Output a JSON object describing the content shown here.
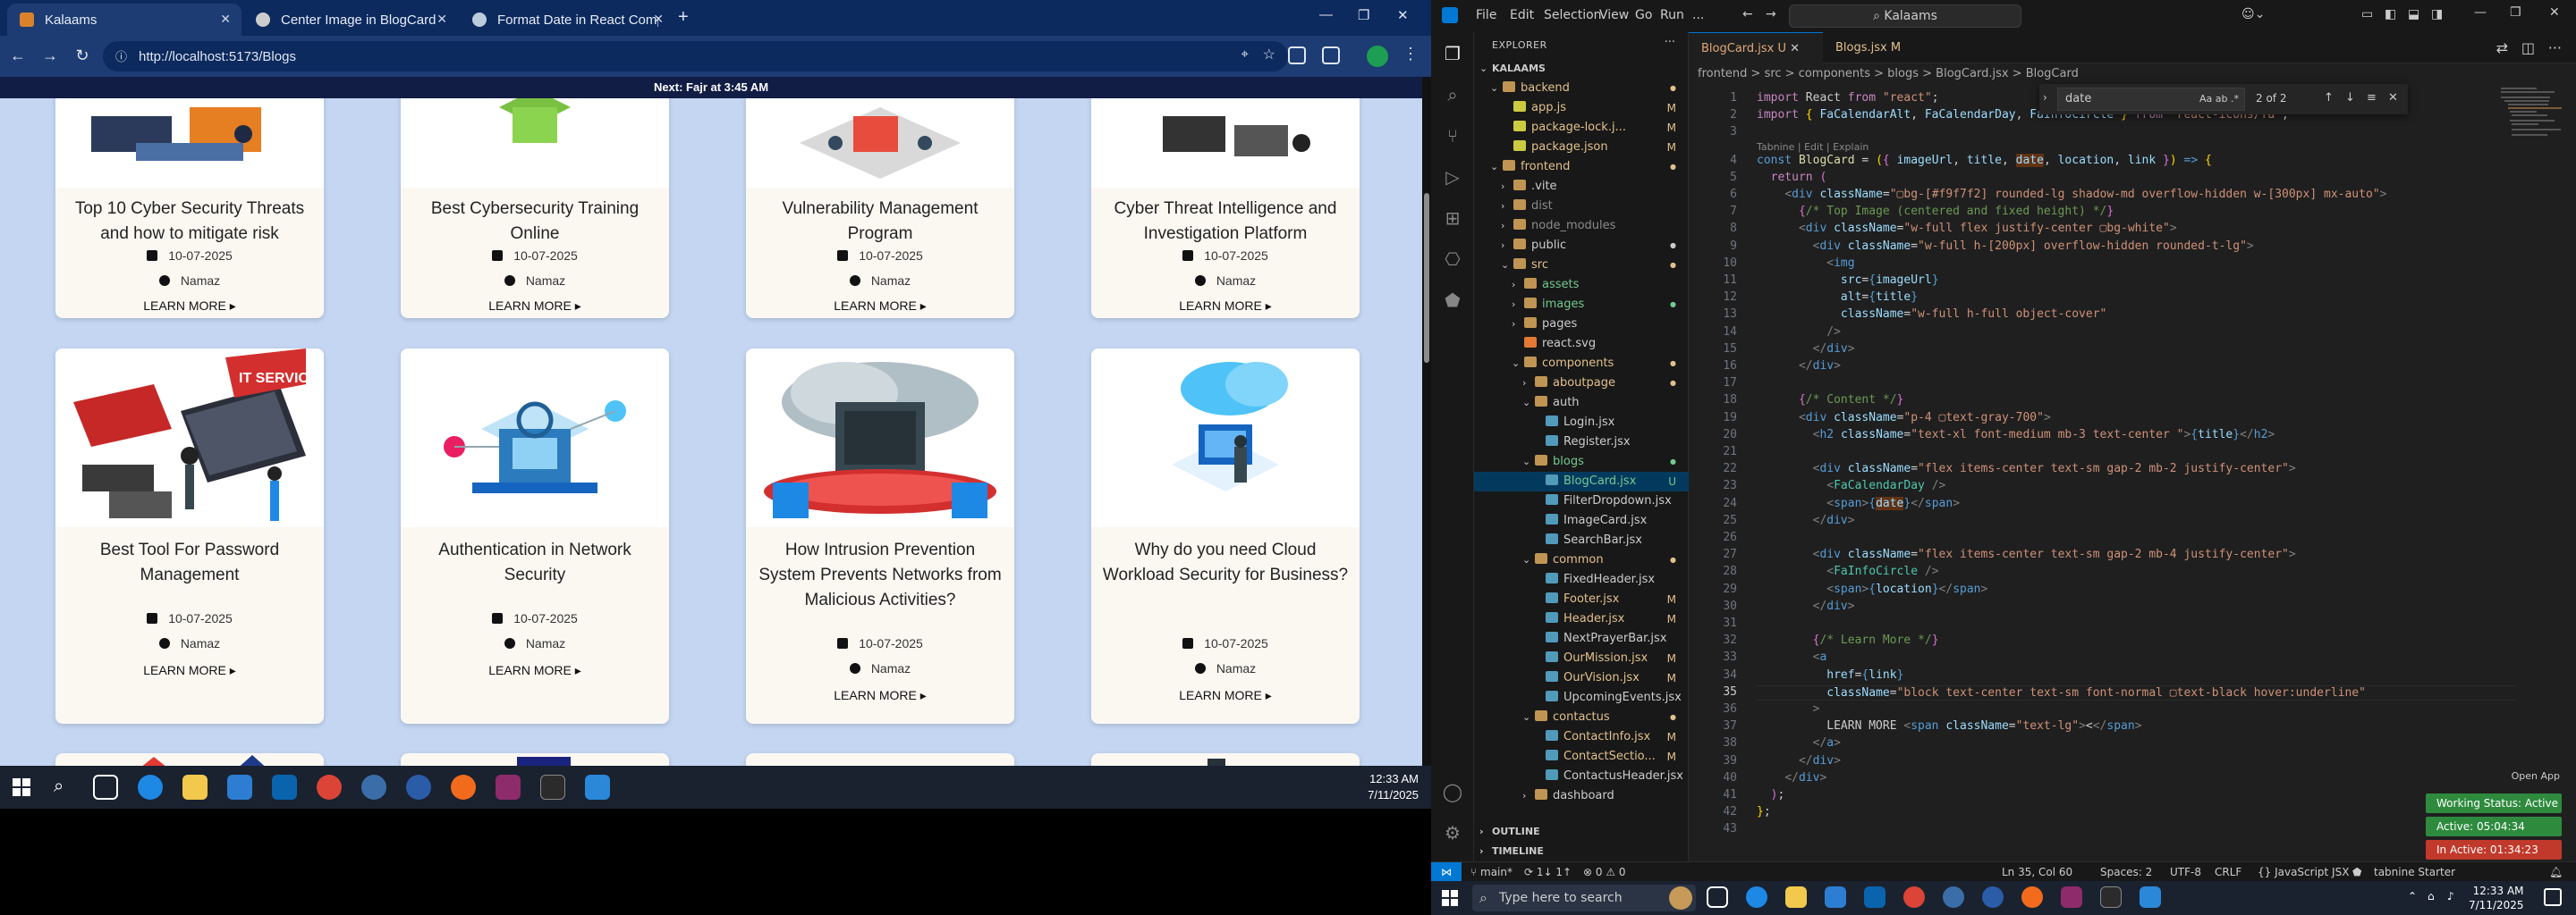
{
  "browser": {
    "tabs": [
      {
        "label": "Kalaams",
        "active": true
      },
      {
        "label": "Center Image in BlogCard",
        "active": false
      },
      {
        "label": "Format Date in React Compone",
        "active": false
      }
    ],
    "url": "http://localhost:5173/Blogs",
    "notice": "Next: Fajr at 3:45 AM"
  },
  "blog": {
    "cards_row1": [
      {
        "title": "Top 10 Cyber Security Threats and how to mitigate risk",
        "date": "10-07-2025",
        "author": "Namaz",
        "more": "LEARN MORE ▸"
      },
      {
        "title": "Best Cybersecurity Training Online",
        "date": "10-07-2025",
        "author": "Namaz",
        "more": "LEARN MORE ▸"
      },
      {
        "title": "Vulnerability Management Program",
        "date": "10-07-2025",
        "author": "Namaz",
        "more": "LEARN MORE ▸"
      },
      {
        "title": "Cyber Threat Intelligence and Investigation Platform",
        "date": "10-07-2025",
        "author": "Namaz",
        "more": "LEARN MORE ▸"
      }
    ],
    "cards_row2": [
      {
        "title": "Best Tool For Password Management",
        "date": "10-07-2025",
        "author": "Namaz",
        "more": "LEARN MORE ▸",
        "img_text": "IT SERVICE"
      },
      {
        "title": "Authentication in Network Security",
        "date": "10-07-2025",
        "author": "Namaz",
        "more": "LEARN MORE ▸"
      },
      {
        "title": "How Intrusion Prevention System Prevents Networks from Malicious Activities?",
        "date": "10-07-2025",
        "author": "Namaz",
        "more": "LEARN MORE ▸"
      },
      {
        "title": "Why do you need Cloud Workload Security for Business?",
        "date": "10-07-2025",
        "author": "Namaz",
        "more": "LEARN MORE ▸"
      }
    ]
  },
  "left_taskbar": {
    "time": "12:33 AM",
    "date": "7/11/2025"
  },
  "vscode": {
    "menu": [
      "File",
      "Edit",
      "Selection",
      "View",
      "Go",
      "Run",
      "..."
    ],
    "command_center": "Kalaams",
    "explorer_title": "EXPLORER",
    "tree": [
      {
        "label": "KALAAMS",
        "indent": 0,
        "chev": "⌄",
        "kind": "root",
        "status": ""
      },
      {
        "label": "backend",
        "indent": 1,
        "chev": "⌄",
        "kind": "folder",
        "status": "dot",
        "color": "#e2c08d"
      },
      {
        "label": "app.js",
        "indent": 2,
        "chev": "",
        "kind": "js",
        "status": "M",
        "color": "#e2c08d"
      },
      {
        "label": "package-lock.j...",
        "indent": 2,
        "chev": "",
        "kind": "json",
        "status": "M",
        "color": "#e2c08d"
      },
      {
        "label": "package.json",
        "indent": 2,
        "chev": "",
        "kind": "json",
        "status": "M",
        "color": "#e2c08d"
      },
      {
        "label": "frontend",
        "indent": 1,
        "chev": "⌄",
        "kind": "folder",
        "status": "dot",
        "color": "#e2c08d"
      },
      {
        "label": ".vite",
        "indent": 2,
        "chev": "›",
        "kind": "folder",
        "status": "",
        "color": "#ccc"
      },
      {
        "label": "dist",
        "indent": 2,
        "chev": "›",
        "kind": "folder",
        "status": "",
        "color": "#8c8c8c"
      },
      {
        "label": "node_modules",
        "indent": 2,
        "chev": "›",
        "kind": "folder",
        "status": "",
        "color": "#8c8c8c"
      },
      {
        "label": "public",
        "indent": 2,
        "chev": "›",
        "kind": "folder",
        "status": "dot",
        "color": "#ccc"
      },
      {
        "label": "src",
        "indent": 2,
        "chev": "⌄",
        "kind": "folder",
        "status": "dot",
        "color": "#e2c08d"
      },
      {
        "label": "assets",
        "indent": 3,
        "chev": "›",
        "kind": "folder",
        "status": "",
        "color": "#73c991"
      },
      {
        "label": "images",
        "indent": 3,
        "chev": "›",
        "kind": "folder",
        "status": "dot",
        "color": "#73c991"
      },
      {
        "label": "pages",
        "indent": 3,
        "chev": "›",
        "kind": "folder",
        "status": "",
        "color": "#ccc"
      },
      {
        "label": "react.svg",
        "indent": 3,
        "chev": "",
        "kind": "svg",
        "status": "",
        "color": "#ccc"
      },
      {
        "label": "components",
        "indent": 3,
        "chev": "⌄",
        "kind": "folder",
        "status": "dot",
        "color": "#e2c08d"
      },
      {
        "label": "aboutpage",
        "indent": 4,
        "chev": "›",
        "kind": "folder",
        "status": "dot",
        "color": "#e2c08d"
      },
      {
        "label": "auth",
        "indent": 4,
        "chev": "⌄",
        "kind": "folder",
        "status": "",
        "color": "#ccc"
      },
      {
        "label": "Login.jsx",
        "indent": 5,
        "chev": "",
        "kind": "jsx",
        "status": "",
        "color": "#ccc"
      },
      {
        "label": "Register.jsx",
        "indent": 5,
        "chev": "",
        "kind": "jsx",
        "status": "",
        "color": "#ccc"
      },
      {
        "label": "blogs",
        "indent": 4,
        "chev": "⌄",
        "kind": "folder",
        "status": "dot",
        "color": "#73c991"
      },
      {
        "label": "BlogCard.jsx",
        "indent": 5,
        "chev": "",
        "kind": "jsx",
        "status": "U",
        "color": "#73c991",
        "selected": true
      },
      {
        "label": "FilterDropdown.jsx",
        "indent": 5,
        "chev": "",
        "kind": "jsx",
        "status": "",
        "color": "#ccc"
      },
      {
        "label": "ImageCard.jsx",
        "indent": 5,
        "chev": "",
        "kind": "jsx",
        "status": "",
        "color": "#ccc"
      },
      {
        "label": "SearchBar.jsx",
        "indent": 5,
        "chev": "",
        "kind": "jsx",
        "status": "",
        "color": "#ccc"
      },
      {
        "label": "common",
        "indent": 4,
        "chev": "⌄",
        "kind": "folder",
        "status": "dot",
        "color": "#e2c08d"
      },
      {
        "label": "FixedHeader.jsx",
        "indent": 5,
        "chev": "",
        "kind": "jsx",
        "status": "",
        "color": "#ccc"
      },
      {
        "label": "Footer.jsx",
        "indent": 5,
        "chev": "",
        "kind": "jsx",
        "status": "M",
        "color": "#e2c08d"
      },
      {
        "label": "Header.jsx",
        "indent": 5,
        "chev": "",
        "kind": "jsx",
        "status": "M",
        "color": "#e2c08d"
      },
      {
        "label": "NextPrayerBar.jsx",
        "indent": 5,
        "chev": "",
        "kind": "jsx",
        "status": "",
        "color": "#ccc"
      },
      {
        "label": "OurMission.jsx",
        "indent": 5,
        "chev": "",
        "kind": "jsx",
        "status": "M",
        "color": "#e2c08d"
      },
      {
        "label": "OurVision.jsx",
        "indent": 5,
        "chev": "",
        "kind": "jsx",
        "status": "M",
        "color": "#e2c08d"
      },
      {
        "label": "UpcomingEvents.jsx",
        "indent": 5,
        "chev": "",
        "kind": "jsx",
        "status": "",
        "color": "#ccc"
      },
      {
        "label": "contactus",
        "indent": 4,
        "chev": "⌄",
        "kind": "folder",
        "status": "dot",
        "color": "#e2c08d"
      },
      {
        "label": "ContactInfo.jsx",
        "indent": 5,
        "chev": "",
        "kind": "jsx",
        "status": "M",
        "color": "#e2c08d"
      },
      {
        "label": "ContactSectio...",
        "indent": 5,
        "chev": "",
        "kind": "jsx",
        "status": "M",
        "color": "#e2c08d"
      },
      {
        "label": "ContactusHeader.jsx",
        "indent": 5,
        "chev": "",
        "kind": "jsx",
        "status": "",
        "color": "#ccc"
      },
      {
        "label": "dashboard",
        "indent": 4,
        "chev": "›",
        "kind": "folder",
        "status": "",
        "color": "#ccc"
      }
    ],
    "outline": "OUTLINE",
    "timeline": "TIMELINE",
    "editor_tabs": [
      {
        "label": "BlogCard.jsx U",
        "active": true
      },
      {
        "label": "Blogs.jsx M",
        "active": false
      }
    ],
    "breadcrumb": "frontend > src > components > blogs > BlogCard.jsx > BlogCard",
    "find": {
      "query": "date",
      "result": "2 of 2"
    },
    "codelens": "Tabnine | Edit | Explain",
    "current_line": 35,
    "code_lines": [
      "<k>import</k> React <k>from</k> <s>\"react\"</s>;",
      "<k>import</k> <y>{</y> <v>FaCalendarAlt</v>, <v>FaCalendarDay</v>, <v>FaInfoCircle</v> <y>}</y> <k>from</k> <s>\"react-icons/fa\"</s>;",
      "",
      "<b>const</b> <f>BlogCard</f> = <y>(</y><p>{</p> <v>imageUrl</v>, <v>title</v>, <v><span class=\"hl\">date</span></v>, <v>location</v>, <v>link</v> <p>}</p><y>)</y> <b>=></b> <y>{</y>",
      "  <k>return</k> <p>(</p>",
      "    <g>&lt;</g><b>div</b> <v>className</v>=<s>\"▢bg-[#f9f7f2] rounded-lg shadow-md overflow-hidden w-[300px] mx-auto\"</s><g>&gt;</g>",
      "      <p>{</p><c>/* Top Image (centered and fixed height) */</c><p>}</p>",
      "      <g>&lt;</g><b>div</b> <v>className</v>=<s>\"w-full flex justify-center ▢bg-white\"</s><g>&gt;</g>",
      "        <g>&lt;</g><b>div</b> <v>className</v>=<s>\"w-full h-[200px] overflow-hidden rounded-t-lg\"</s><g>&gt;</g>",
      "          <g>&lt;</g><b>img</b>",
      "            <v>src</v>=<b>{</b><v>imageUrl</v><b>}</b>",
      "            <v>alt</v>=<b>{</b><v>title</v><b>}</b>",
      "            <v>className</v>=<s>\"w-full h-full object-cover\"</s>",
      "          <g>/&gt;</g>",
      "        <g>&lt;/</g><b>div</b><g>&gt;</g>",
      "      <g>&lt;/</g><b>div</b><g>&gt;</g>",
      "",
      "      <p>{</p><c>/* Content */</c><p>}</p>",
      "      <g>&lt;</g><b>div</b> <v>className</v>=<s>\"p-4 ▢text-gray-700\"</s><g>&gt;</g>",
      "        <g>&lt;</g><b>h2</b> <v>className</v>=<s>\"text-xl font-medium mb-3 text-center \"</s><g>&gt;</g><b>{</b><v>title</v><b>}</b><g>&lt;/</g><b>h2</b><g>&gt;</g>",
      "",
      "        <g>&lt;</g><b>div</b> <v>className</v>=<s>\"flex items-center text-sm gap-2 mb-2 justify-center\"</s><g>&gt;</g>",
      "          <g>&lt;</g><t>FaCalendarDay</t> <g>/&gt;</g>",
      "          <g>&lt;</g><b>span</b><g>&gt;</g><b>{</b><v><span class=\"hl\">date</span></v><b>}</b><g>&lt;/</g><b>span</b><g>&gt;</g>",
      "        <g>&lt;/</g><b>div</b><g>&gt;</g>",
      "",
      "        <g>&lt;</g><b>div</b> <v>className</v>=<s>\"flex items-center text-sm gap-2 mb-4 justify-center\"</s><g>&gt;</g>",
      "          <g>&lt;</g><t>FaInfoCircle</t> <g>/&gt;</g>",
      "          <g>&lt;</g><b>span</b><g>&gt;</g><b>{</b><v>location</v><b>}</b><g>&lt;/</g><b>span</b><g>&gt;</g>",
      "        <g>&lt;/</g><b>div</b><g>&gt;</g>",
      "",
      "        <p>{</p><c>/* Learn More */</c><p>}</p>",
      "        <g>&lt;</g><b>a</b>",
      "          <v>href</v>=<b>{</b><v>link</v><b>}</b>",
      "          <v>className</v>=<s>\"block text-center text-sm font-normal ▢text-black hover:underline\"</s>",
      "        <g>&gt;</g>",
      "          LEARN MORE <g>&lt;</g><b>span</b> <v>className</v>=<s>\"text-lg\"</s><g>&gt;</g>&lt;<g>&lt;/</g><b>span</b><g>&gt;</g>",
      "        <g>&lt;/</g><b>a</b><g>&gt;</g>",
      "      <g>&lt;/</g><b>div</b><g>&gt;</g>",
      "    <g>&lt;/</g><b>div</b><g>&gt;</g>",
      "  <p>)</p>;",
      "<y>}</y>;",
      ""
    ],
    "open_app": "Open App",
    "badges": [
      {
        "label": "Working Status: Active",
        "color": "#2e8b3e"
      },
      {
        "label": "Active: 05:04:34",
        "color": "#2e8b3e"
      },
      {
        "label": "In Active: 01:34:23",
        "color": "#c0392b"
      }
    ],
    "status_left": [
      "main*",
      "⟳ 1↓ 1↑",
      "⊗ 0 ⚠ 0"
    ],
    "status_right": [
      "Ln 35, Col 60",
      "Spaces: 2",
      "UTF-8",
      "CRLF",
      "{} JavaScript JSX",
      "tabnine Starter"
    ],
    "taskbar_search": "Type here to search",
    "time": "12:33 AM",
    "date": "7/11/2025"
  },
  "colors": {
    "page_bg": "#c4d6f2",
    "card_bg": "#fbf8f2",
    "vscode_bg": "#1f1f1f",
    "accent": "#0078d4"
  }
}
